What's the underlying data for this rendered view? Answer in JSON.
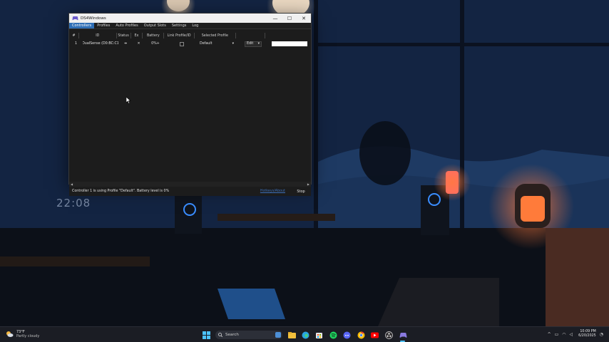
{
  "window": {
    "title": "DS4Windows",
    "minimize_glyph": "—",
    "maximize_glyph": "☐",
    "close_glyph": "✕"
  },
  "tabs": [
    "Controllers",
    "Profiles",
    "Auto Profiles",
    "Output Slots",
    "Settings",
    "Log"
  ],
  "active_tab": "Controllers",
  "columns": [
    "#",
    "ID",
    "Status",
    "Ex",
    "Battery",
    "Link Profile/ID",
    "Selected Profile"
  ],
  "controllers": [
    {
      "index": "1",
      "id": "DualSense (D0:BC:C1",
      "status": "⇴",
      "exclusive": "✕",
      "battery": "0%+",
      "selected_profile": "Default",
      "edit_label": "Edit"
    }
  ],
  "status_message": "Controller 1 is using Profile \"Default\". Battery level is 0%",
  "hotkeys_label": "Hotkeys/About",
  "stop_label": "Stop",
  "wallpaper_clock": "22:08",
  "taskbar": {
    "weather_temp": "73°F",
    "weather_desc": "Partly cloudy",
    "search_label": "Search",
    "time": "10:09 PM",
    "date": "6/20/2025"
  },
  "colors": {
    "accent": "#2f6fb6",
    "window_bg": "#1c1c1c",
    "link": "#3c6fb8"
  }
}
